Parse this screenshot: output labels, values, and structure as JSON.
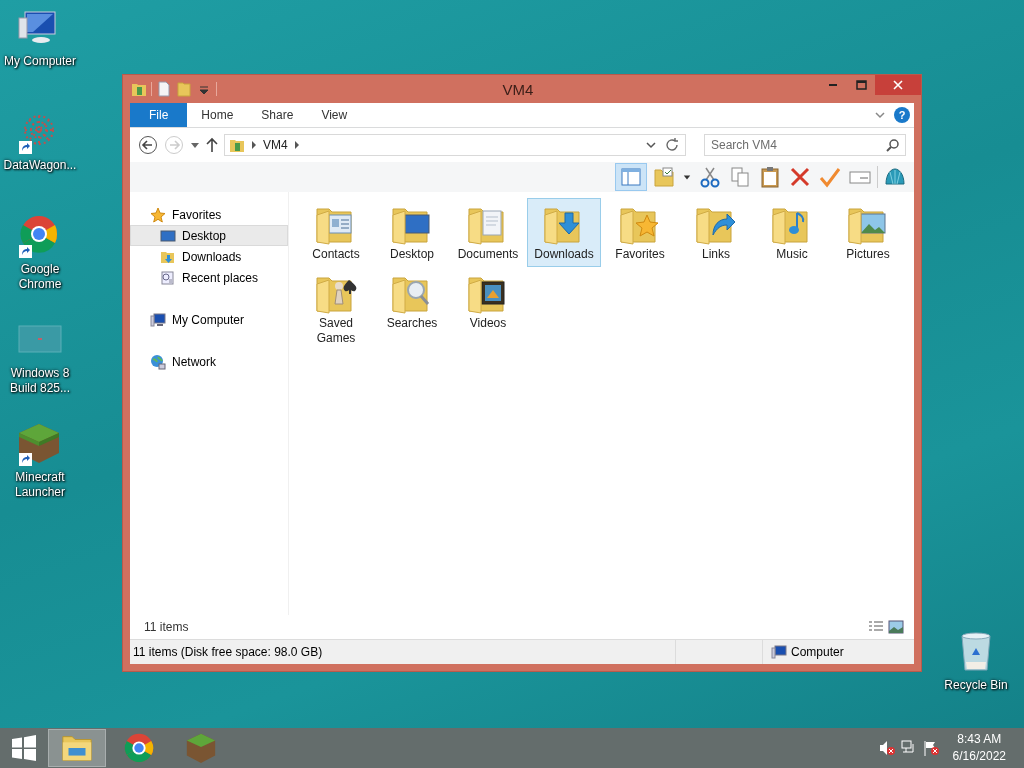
{
  "desktop_icons": [
    {
      "label": "My Computer",
      "kind": "computer",
      "shortcut": false
    },
    {
      "label": "DataWagon...",
      "kind": "datawagon",
      "shortcut": true
    },
    {
      "label": "Google Chrome",
      "kind": "chrome",
      "shortcut": true
    },
    {
      "label": "Windows 8 Build 825...",
      "kind": "vm",
      "shortcut": false
    },
    {
      "label": "Minecraft Launcher",
      "kind": "minecraft",
      "shortcut": true
    }
  ],
  "recycle_bin": {
    "label": "Recycle Bin"
  },
  "window": {
    "title": "VM4",
    "ribbon_tabs": [
      {
        "label": "File",
        "kind": "file"
      },
      {
        "label": "Home",
        "kind": "tab"
      },
      {
        "label": "Share",
        "kind": "tab"
      },
      {
        "label": "View",
        "kind": "tab"
      }
    ],
    "help": "?",
    "address": {
      "crumbs": [
        "VM4"
      ],
      "forward_disabled": true
    },
    "search": {
      "placeholder": "Search VM4"
    },
    "navigation": [
      {
        "label": "Favorites",
        "kind": "favorites",
        "selected": false,
        "children": [
          {
            "label": "Desktop",
            "kind": "desktop",
            "selected": true
          },
          {
            "label": "Downloads",
            "kind": "downloads",
            "selected": false
          },
          {
            "label": "Recent places",
            "kind": "recent",
            "selected": false
          }
        ]
      },
      {
        "label": "My Computer",
        "kind": "computer",
        "selected": false
      },
      {
        "label": "Network",
        "kind": "network",
        "selected": false
      }
    ],
    "items": [
      {
        "label": "Contacts",
        "kind": "contacts",
        "selected": false
      },
      {
        "label": "Desktop",
        "kind": "desktop",
        "selected": false
      },
      {
        "label": "Documents",
        "kind": "documents",
        "selected": false
      },
      {
        "label": "Downloads",
        "kind": "downloads",
        "selected": true
      },
      {
        "label": "Favorites",
        "kind": "favorites",
        "selected": false
      },
      {
        "label": "Links",
        "kind": "links",
        "selected": false
      },
      {
        "label": "Music",
        "kind": "music",
        "selected": false
      },
      {
        "label": "Pictures",
        "kind": "pictures",
        "selected": false
      },
      {
        "label": "Saved Games",
        "kind": "games",
        "selected": false
      },
      {
        "label": "Searches",
        "kind": "searches",
        "selected": false
      },
      {
        "label": "Videos",
        "kind": "videos",
        "selected": false
      }
    ],
    "item_count": "11 items",
    "status_bar": {
      "text": "11 items (Disk free space: 98.0 GB)",
      "location": "Computer"
    }
  },
  "taskbar": {
    "apps": [
      {
        "kind": "explorer",
        "selected": true
      },
      {
        "kind": "chrome",
        "selected": false
      },
      {
        "kind": "minecraft",
        "selected": false
      }
    ],
    "time": "8:43 AM",
    "date": "6/16/2022"
  }
}
